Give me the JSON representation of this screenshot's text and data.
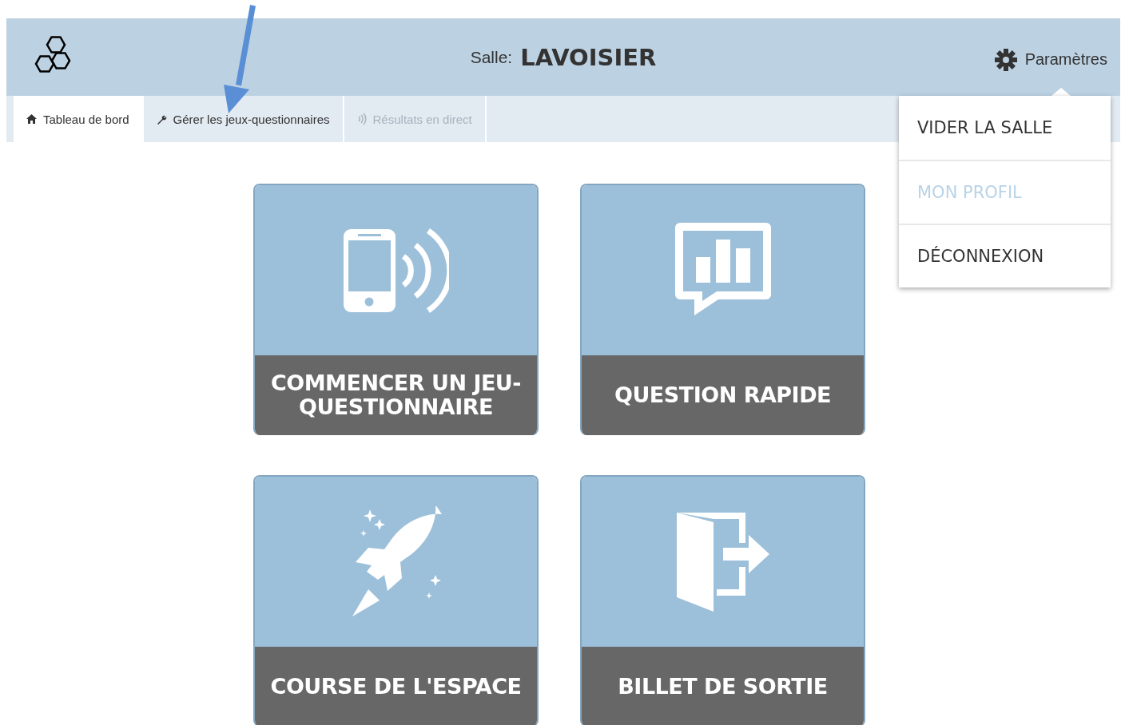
{
  "header": {
    "room_label": "Salle:",
    "room_name": "LAVOISIER",
    "settings_label": "Paramètres"
  },
  "tabs": [
    {
      "label": "Tableau de bord",
      "kind": "home",
      "selected": true,
      "disabled": false
    },
    {
      "label": "Gérer les jeux-questionnaires",
      "kind": "manage",
      "selected": false,
      "disabled": false
    },
    {
      "label": "Résultats en direct",
      "kind": "live",
      "selected": false,
      "disabled": true
    }
  ],
  "settings_menu": {
    "items": [
      {
        "label": "VIDER LA SALLE",
        "disabled": false
      },
      {
        "label": "MON PROFIL",
        "disabled": true
      },
      {
        "label": "DÉCONNEXION",
        "disabled": false
      }
    ]
  },
  "tiles": [
    {
      "kind": "quiz",
      "label": "COMMENCER UN JEU-QUESTIONNAIRE"
    },
    {
      "kind": "quick",
      "label": "QUESTION RAPIDE"
    },
    {
      "kind": "race",
      "label": "COURSE DE L'ESPACE"
    },
    {
      "kind": "exit",
      "label": "BILLET DE SORTIE"
    }
  ],
  "annotation": {
    "kind": "arrow"
  }
}
